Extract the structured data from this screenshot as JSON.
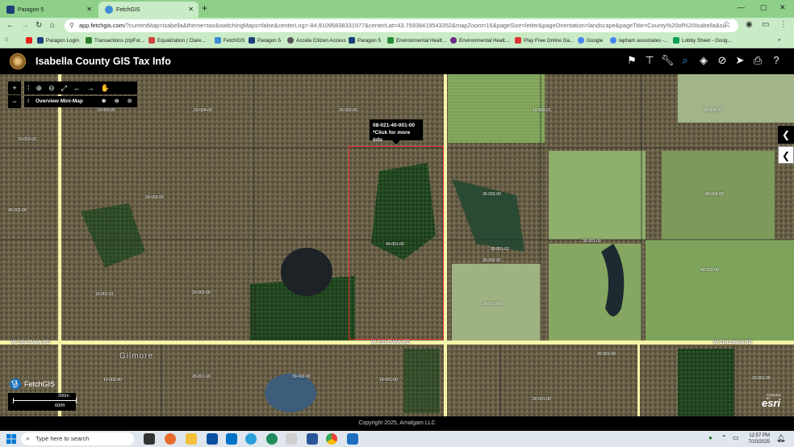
{
  "browser": {
    "tabs": [
      {
        "label": "Paragon 5",
        "active": false
      },
      {
        "label": "FetchGIS",
        "active": true
      }
    ],
    "url_host": "app.fetchgis.com",
    "url_path": "/?currentMap=isabella&theme=tax&switchingMaps=false&centerLng=-84.91095838331977&centerLat=43.75938419543352&mapZoom=16&pageSize=letter&pageOrientation=landscape&pageTitle=County%20of%20Isabella&su...",
    "bookmarks": [
      "Paragon Login",
      "Transactions (zipFor...",
      "Equalization | Clare...",
      "FetchGIS",
      "Paragon 5",
      "Accela Citizen Access",
      "Paragon 5",
      "Environmental Healt...",
      "Environmental Healt...",
      "Play Free Online Ga...",
      "Google",
      "lapham associates -...",
      "Lobby Sheet - Goog..."
    ]
  },
  "app": {
    "title": "Isabella County GIS Tax Info",
    "toolbar_icons": [
      "flag-icon",
      "signpost-icon",
      "wrench-icon",
      "search-icon",
      "layers-icon",
      "location-off-icon",
      "send-icon",
      "print-icon",
      "help-icon"
    ]
  },
  "map": {
    "controls": {
      "zoom_in": "+",
      "zoom_out": "−",
      "overview_label": "Overview Mini-Map"
    },
    "tooltip": {
      "parcel_id": "08-021-40-001-00",
      "hint": "*Click for more info"
    },
    "parcel_labels": [
      "10-003-00",
      "20-004-00",
      "20-003-00",
      "10-003-01",
      "20-004-00",
      "20-003-00",
      "40-002-00",
      "30-003-00",
      "40-001-00",
      "30-003-00",
      "40-004-00",
      "10-001-01",
      "30-002-02",
      "30-001-02",
      "40-003-00",
      "30-001-00",
      "30-001-00",
      "20-002-00",
      "20-001-00",
      "10-002-00",
      "10-001-00",
      "30-002-00",
      "30-001-00",
      "20-001-00",
      "10-001-00"
    ],
    "road_labels": [
      "W COLEMAN RD",
      "W COLEMAN RD",
      "W COLEMAN RD"
    ],
    "place_label": "Gilmore",
    "brand": "FetchGIS",
    "scale": {
      "metric": "200m",
      "imperial": "600ft"
    },
    "attribution": "esri",
    "attribution_small": "POWERED BY"
  },
  "footer": {
    "copyright": "Copyright 2025, Amalgam LLC"
  },
  "taskbar": {
    "search_placeholder": "Type here to search",
    "time": "12:57 PM",
    "date": "7/10/2025"
  }
}
